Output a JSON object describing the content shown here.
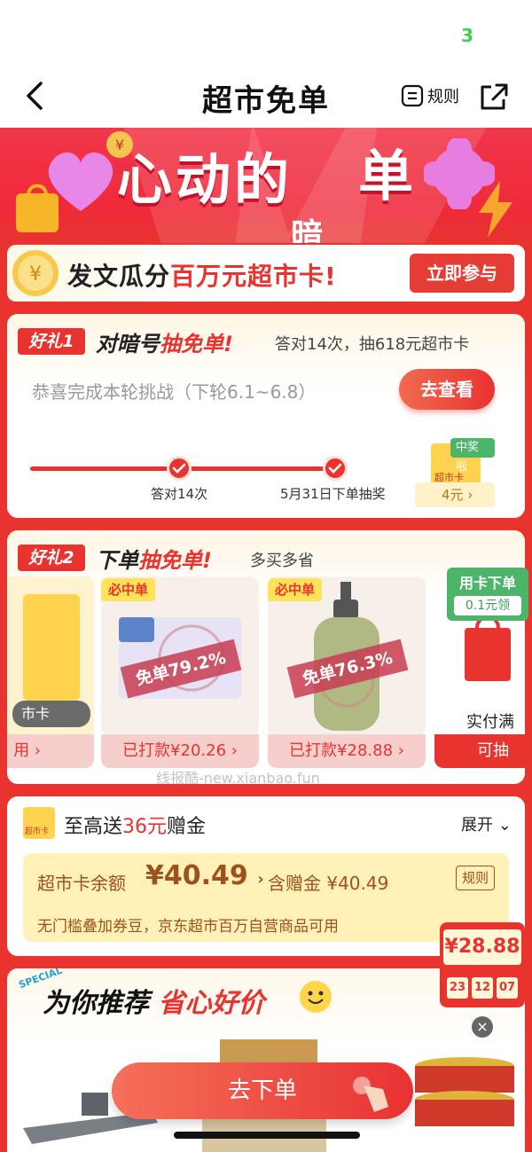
{
  "status": {
    "indicator": "3"
  },
  "nav": {
    "title": "超市免单",
    "rules_label": "规则"
  },
  "hero": {
    "title_left": "心动的",
    "title_right": "单",
    "title_sub": "暗"
  },
  "banner": {
    "text_prefix": "发文瓜分",
    "text_highlight": "百万元超市卡!",
    "button_label": "立即参与"
  },
  "gift1": {
    "tag": "好礼1",
    "title_prefix": "对暗号",
    "title_highlight": "抽免单!",
    "subtitle": "答对14次，抽618元超市卡",
    "status_text": "恭喜完成本轮挑战（下轮6.1~6.8）",
    "view_button": "去查看",
    "steps": [
      "答对14次",
      "5月31日下单抽奖"
    ],
    "prize_badge": "中奖啦",
    "prize_card_label": "超市卡",
    "prize_amount": "4元"
  },
  "gift2": {
    "tag": "好礼2",
    "title_prefix": "下单",
    "title_highlight": "抽免单!",
    "subtitle": "多买多省",
    "left_card_label": "市卡",
    "left_btn_label": "用",
    "products": [
      {
        "badge": "必中单",
        "stamp": "免单79.2%",
        "paid": "已打款¥20.26"
      },
      {
        "badge": "必中单",
        "stamp": "免单76.3%",
        "paid": "已打款¥28.88"
      }
    ],
    "right_card_text": "实付满",
    "right_btn_label": "可抽",
    "side_tag_title": "用卡下单",
    "side_tag_sub": "0.1元领"
  },
  "gift3": {
    "icon_label": "超市卡",
    "title_prefix": "至高送",
    "title_highlight": "36元",
    "title_suffix": "赠金",
    "expand_label": "展开",
    "balance_label": "超市卡余额",
    "balance_value": "¥40.49",
    "gift_value": "含赠金 ¥40.49",
    "rule_chip": "规则",
    "note": "无门槛叠加券豆，京东超市百万自营商品可用"
  },
  "recommend": {
    "special": "SPECIAL",
    "title_prefix": "为你推荐",
    "title_highlight": "省心好价"
  },
  "float_price": {
    "value": "¥28.88",
    "timer": [
      "23",
      "12",
      "07"
    ]
  },
  "order_button": "去下单",
  "watermark": "线报酷-new.xianbao.fun",
  "colors": {
    "primary": "#e8332f",
    "accent_green": "#4db56a",
    "gold": "#ffd34d"
  }
}
